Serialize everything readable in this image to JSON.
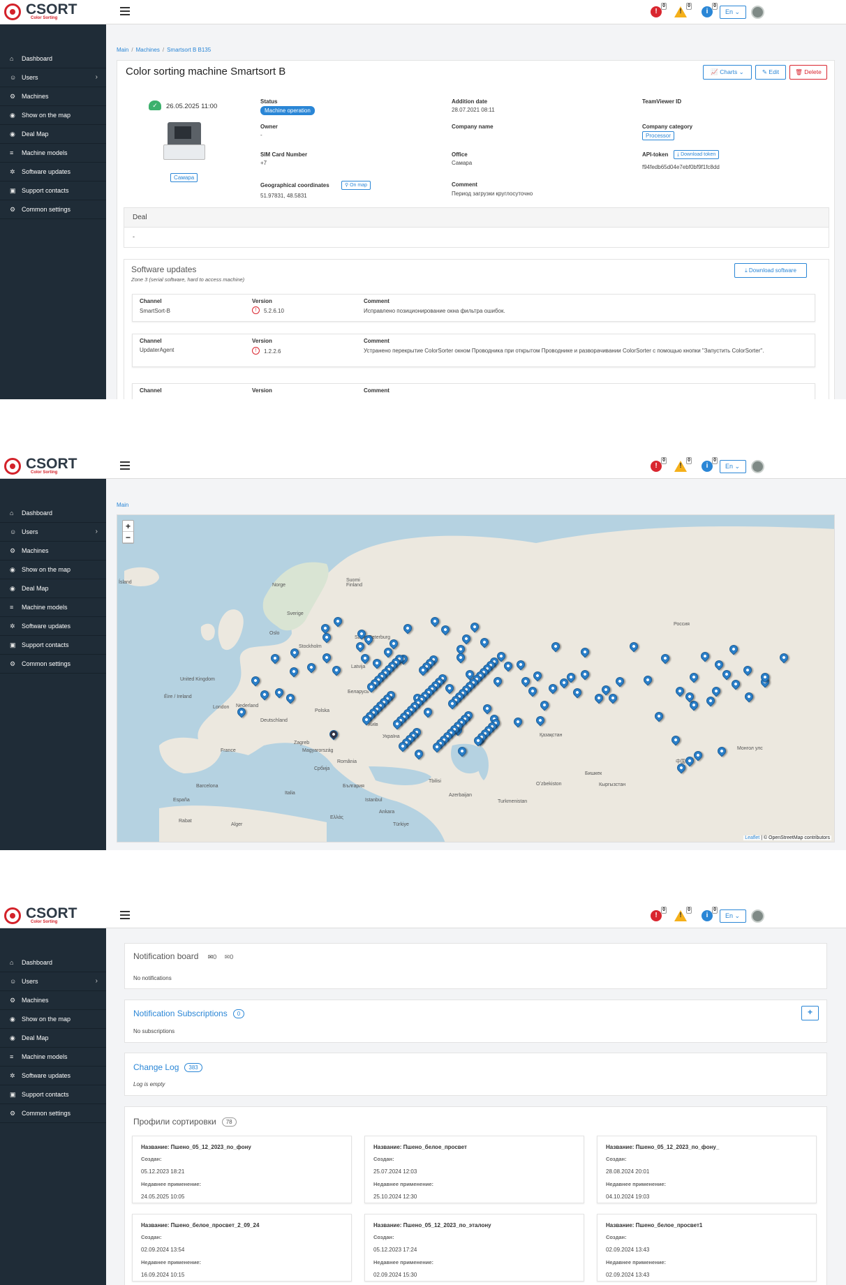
{
  "app": {
    "brand": "CSORT",
    "brand_sub": "Color Sorting",
    "lang": "En"
  },
  "notif": {
    "errors": "0",
    "warnings": "0",
    "info": "0"
  },
  "sidebar": {
    "items": [
      {
        "label": "Dashboard",
        "icon": "home-icon"
      },
      {
        "label": "Users",
        "icon": "user-icon"
      },
      {
        "label": "Machines",
        "icon": "gear-icon"
      },
      {
        "label": "Show on the map",
        "icon": "globe-icon"
      },
      {
        "label": "Deal Map",
        "icon": "globe-icon"
      },
      {
        "label": "Machine models",
        "icon": "database-icon"
      },
      {
        "label": "Software updates",
        "icon": "cog-icon"
      },
      {
        "label": "Support contacts",
        "icon": "briefcase-icon"
      },
      {
        "label": "Common settings",
        "icon": "gear-icon"
      }
    ]
  },
  "s1": {
    "breadcrumb": [
      "Main",
      "Machines",
      "Smartsort B B135"
    ],
    "title": "Color sorting machine Smartsort B",
    "charts_label": "Charts",
    "edit_label": "Edit",
    "delete_label": "Delete",
    "online_date": "26.05.2025 11:00",
    "city_tag": "Самара",
    "status_label": "Status",
    "status_value": "Machine operation",
    "owner_label": "Owner",
    "owner_value": "-",
    "sim_label": "SIM Card Number",
    "sim_value": "+7",
    "geo_label": "Geographical coordinates",
    "on_map_label": "On map",
    "geo_value": "51.97831,  48.5831",
    "added_label": "Addition date",
    "added_value": "28.07.2021 08:11",
    "company_label": "Company name",
    "office_label": "Office",
    "office_value": "Самара",
    "comment_label": "Comment",
    "comment_value": "Период загрузки круглосуточно",
    "teamviewer_label": "TeamViewer ID",
    "company_cat_label": "Company category",
    "company_cat_value": "Processor",
    "api_label": "API-token",
    "download_token_label": "Download token",
    "api_value": "f94fedb65d04e7ebf0bf9f1fc8dd",
    "deal_label": "Deal",
    "deal_value": "-",
    "sw_title": "Software updates",
    "sw_zone": "Zone 3 (serial software, hard to access machine)",
    "download_software_label": "Download software",
    "col_channel": "Channel",
    "col_version": "Version",
    "col_comment": "Comment",
    "updates": [
      {
        "channel": "SmartSort-B",
        "version": "5.2.6.10",
        "comment": "Исправлено позиционирование окна фильтра ошибок."
      },
      {
        "channel": "UpdaterAgent",
        "version": "1.2.2.6",
        "comment": "Устранено перекрытие ColorSorter окном Проводника при открытом Проводнике и разворачивании ColorSorter с помощью кнопки \"Запустить ColorSorter\"."
      }
    ]
  },
  "s2": {
    "breadcrumb": "Main",
    "zoom_in": "+",
    "zoom_out": "−",
    "attribution_leaflet": "Leaflet",
    "attribution_rest": " | © OpenStreetMap contributors",
    "attribution_osm": "OpenStreetMap",
    "labels": [
      "Ísland",
      "Norge",
      "Suomi Finland",
      "Sverige",
      "Oslo",
      "Stockholm",
      "United Kingdom",
      "Éire / Ireland",
      "London",
      "Nederland",
      "Deutschland",
      "France",
      "España",
      "Italia",
      "Polska",
      "Беларусь",
      "Україна",
      "Київ",
      "Magyarország",
      "România",
      "България",
      "Istanbul",
      "Ελλάς",
      "Ankara",
      "Türkiye",
      "Azerbaijan",
      "Қазақстан",
      "Oʻzbekiston",
      "Turkmenistan",
      "Кыргызстан",
      "Бишкек",
      "Россия",
      "Монгол улс",
      "中国",
      "Sankt-Peterburg",
      "Barcelona",
      "Rabat",
      "Alger",
      "Tbilisi",
      "Latvija",
      "Zagreb",
      "Србија"
    ]
  },
  "s3": {
    "notif_board_title": "Notification board",
    "notif_mail_count": "0",
    "notif_read_count": "0",
    "no_notifications": "No notifications",
    "subs_title": "Notification Subscriptions",
    "subs_count": "0",
    "no_subs": "No subscriptions",
    "add_label": "+",
    "changelog_title": "Change Log",
    "changelog_count": "383",
    "log_empty": "Log is empty",
    "profiles_title": "Профили сортировки",
    "profiles_count": "78",
    "created_label": "Создан:",
    "recent_label": "Недавнее применение:",
    "profiles": [
      {
        "name": "Название: Пшено_05_12_2023_по_фону",
        "created": "05.12.2023 18:21",
        "recent": "24.05.2025 10:05"
      },
      {
        "name": "Название: Пшено_белое_просвет",
        "created": "25.07.2024 12:03",
        "recent": "25.10.2024 12:30"
      },
      {
        "name": "Название: Пшено_05_12_2023_по_фону_",
        "created": "28.08.2024 20:01",
        "recent": "04.10.2024 19:03"
      },
      {
        "name": "Название: Пшено_белое_просвет_2_09_24",
        "created": "02.09.2024 13:54",
        "recent": "16.09.2024 10:15"
      },
      {
        "name": "Название: Пшено_05_12_2023_по_эталону",
        "created": "05.12.2023 17:24",
        "recent": "02.09.2024 15:30"
      },
      {
        "name": "Название: Пшено_белое_просвет1",
        "created": "02.09.2024 13:43",
        "recent": "02.09.2024 13:43"
      }
    ]
  }
}
